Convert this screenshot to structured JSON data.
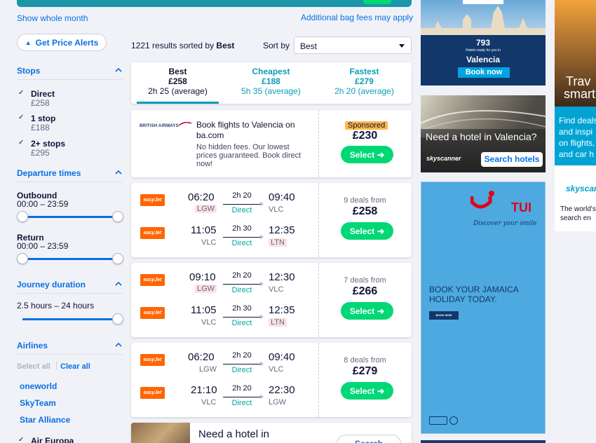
{
  "top": {
    "show_month": "Show whole month",
    "bag_fees": "Additional bag fees may apply"
  },
  "sidebar": {
    "price_alerts": "Get Price Alerts",
    "stops_title": "Stops",
    "stops": [
      {
        "label": "Direct",
        "price": "£258"
      },
      {
        "label": "1 stop",
        "price": "£188"
      },
      {
        "label": "2+ stops",
        "price": "£295"
      }
    ],
    "departure_title": "Departure times",
    "outbound_label": "Outbound",
    "outbound_range": "00:00 – 23:59",
    "return_label": "Return",
    "return_range": "00:00 – 23:59",
    "duration_title": "Journey duration",
    "duration_range": "2.5 hours – 24 hours",
    "airlines_title": "Airlines",
    "select_all": "Select all",
    "clear_all": "Clear all",
    "alliances": [
      "oneworld",
      "SkyTeam",
      "Star Alliance"
    ],
    "airline_first": "Air Europa"
  },
  "results": {
    "count_text": "1221 results sorted by",
    "sorted_by": "Best",
    "sort_label": "Sort by",
    "sort_value": "Best"
  },
  "tabs": [
    {
      "label": "Best",
      "price": "£258",
      "time": "2h 25 (average)",
      "active": true
    },
    {
      "label": "Cheapest",
      "price": "£188",
      "time": "5h 35 (average)",
      "active": false
    },
    {
      "label": "Fastest",
      "price": "£279",
      "time": "2h 20 (average)",
      "active": false
    }
  ],
  "sponsored": {
    "airline": "BRITISH AIRWAYS",
    "headline": "Book flights to Valencia on ba.com",
    "body": "No hidden fees. Our lowest prices guaranteed. Book direct now!",
    "tag": "Sponsored",
    "price": "£230",
    "select": "Select"
  },
  "flights": [
    {
      "deals": "9 deals from",
      "price": "£258",
      "select": "Select",
      "legs": [
        {
          "airline": "easyJet",
          "dep": "06:20",
          "dep_ap": "LGW",
          "dep_warn": true,
          "dur": "2h 20",
          "stops": "Direct",
          "arr": "09:40",
          "arr_ap": "VLC",
          "arr_warn": false
        },
        {
          "airline": "easyJet",
          "dep": "11:05",
          "dep_ap": "VLC",
          "dep_warn": false,
          "dur": "2h 30",
          "stops": "Direct",
          "arr": "12:35",
          "arr_ap": "LTN",
          "arr_warn": true
        }
      ]
    },
    {
      "deals": "7 deals from",
      "price": "£266",
      "select": "Select",
      "legs": [
        {
          "airline": "easyJet",
          "dep": "09:10",
          "dep_ap": "LGW",
          "dep_warn": true,
          "dur": "2h 20",
          "stops": "Direct",
          "arr": "12:30",
          "arr_ap": "VLC",
          "arr_warn": false
        },
        {
          "airline": "easyJet",
          "dep": "11:05",
          "dep_ap": "VLC",
          "dep_warn": false,
          "dur": "2h 30",
          "stops": "Direct",
          "arr": "12:35",
          "arr_ap": "LTN",
          "arr_warn": true
        }
      ]
    },
    {
      "deals": "8 deals from",
      "price": "£279",
      "select": "Select",
      "legs": [
        {
          "airline": "easyJet",
          "dep": "06:20",
          "dep_ap": "LGW",
          "dep_warn": false,
          "dur": "2h 20",
          "stops": "Direct",
          "arr": "09:40",
          "arr_ap": "VLC",
          "arr_warn": false
        },
        {
          "airline": "easyJet",
          "dep": "21:10",
          "dep_ap": "VLC",
          "dep_warn": false,
          "dur": "2h 20",
          "stops": "Direct",
          "arr": "22:30",
          "arr_ap": "LGW",
          "arr_warn": false
        }
      ]
    }
  ],
  "hotel_teaser": {
    "title": "Need a hotel in",
    "button": "Search"
  },
  "ads": {
    "valencia_count": "793",
    "valencia_sub": "Hotels ready for you in",
    "valencia_city": "Valencia",
    "valencia_btn": "Book now",
    "hotel_q": "Need a hotel in Valencia?",
    "hotel_brand": "skyscanner",
    "hotel_btn": "Search hotels",
    "tui_brand": "TUI",
    "tui_tagline": "Discover your smile",
    "tui_headline": "BOOK YOUR JAMAICA HOLIDAY TODAY.",
    "tui_btn": "BOOK NOW",
    "side_travel": "Trav",
    "side_smart": "smart",
    "side_body": "Find deals and inspi on flights, and car h",
    "side_brand": "skyscan",
    "side_tag": "The world's search en"
  },
  "colors": {
    "accent": "#0770e3",
    "teal": "#0a9eb8",
    "green": "#00d775",
    "easyjet": "#ff6600",
    "warn_bg": "#fde1e3",
    "tui_bg": "#4da9df"
  }
}
